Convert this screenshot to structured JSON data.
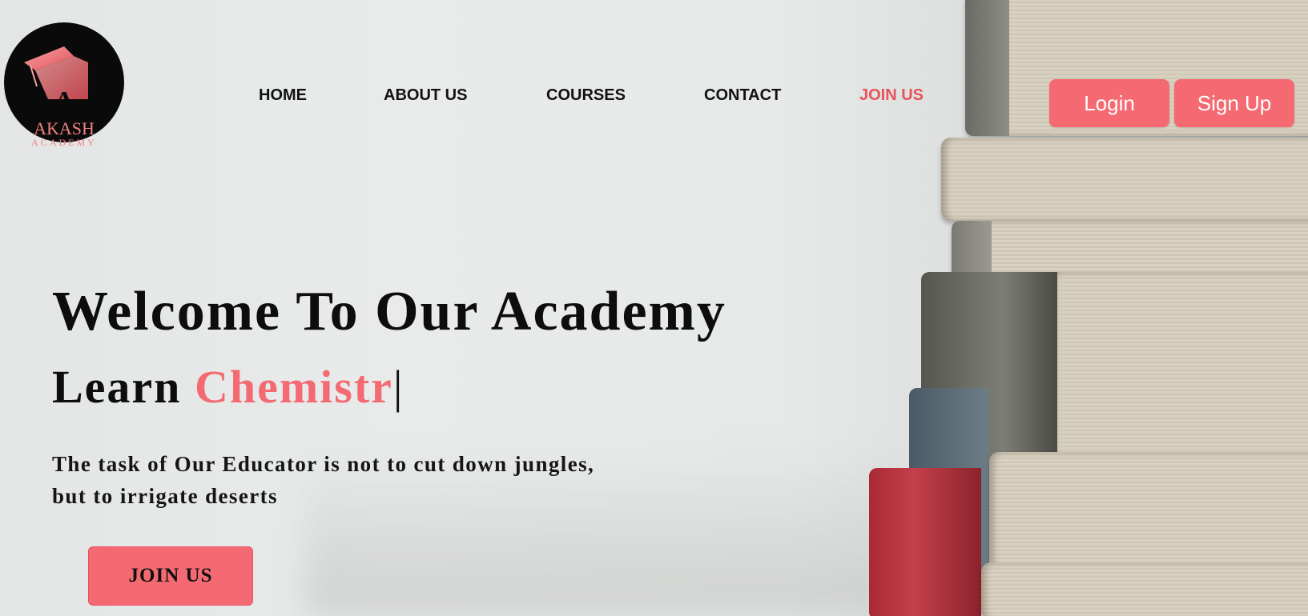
{
  "brand": {
    "letter": "A",
    "name": "AKASH",
    "sub": "ACADEMY"
  },
  "nav": {
    "items": [
      {
        "label": "HOME"
      },
      {
        "label": "ABOUT US"
      },
      {
        "label": "COURSES"
      },
      {
        "label": "CONTACT"
      },
      {
        "label": "JOIN US",
        "active": true
      }
    ]
  },
  "auth": {
    "login_label": "Login",
    "signup_label": "Sign Up"
  },
  "hero": {
    "title": "Welcome To Our Academy",
    "sub_prefix": "Learn ",
    "sub_accent": "Chemistr",
    "cursor": "|",
    "tagline_line1": "The task of Our Educator is not to cut down jungles,",
    "tagline_line2": "but to irrigate deserts",
    "cta_label": "JOIN US"
  },
  "colors": {
    "accent": "#f56a72",
    "active_nav": "#e8535d",
    "text": "#0d0d0d"
  }
}
